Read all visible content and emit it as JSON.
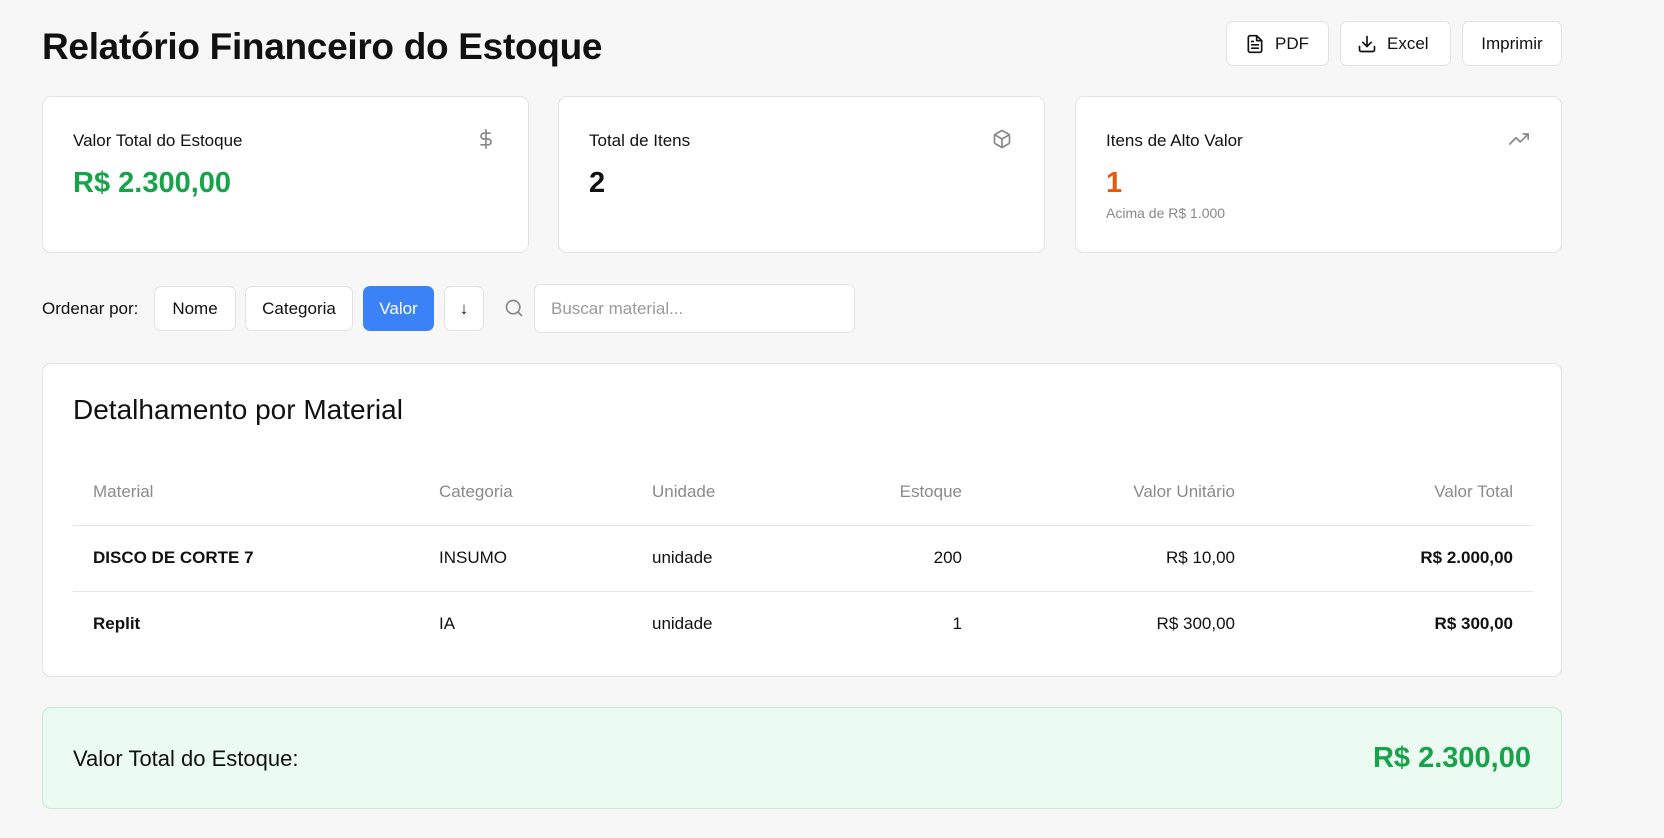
{
  "header": {
    "title": "Relatório Financeiro do Estoque",
    "actions": {
      "pdf_label": "PDF",
      "excel_label": "Excel",
      "print_label": "Imprimir"
    }
  },
  "stats": [
    {
      "label": "Valor Total do Estoque",
      "value": "R$ 2.300,00",
      "icon": "dollar-icon",
      "color": "#16a34a"
    },
    {
      "label": "Total de Itens",
      "value": "2",
      "icon": "package-icon",
      "color": "#111111"
    },
    {
      "label": "Itens de Alto Valor",
      "value": "1",
      "sub": "Acima de R$ 1.000",
      "icon": "trending-up-icon",
      "color": "#ea580c"
    }
  ],
  "toolbar": {
    "sort_label": "Ordenar por:",
    "sort_options": [
      "Nome",
      "Categoria",
      "Valor"
    ],
    "active_sort": "Valor",
    "direction": "↓",
    "search_placeholder": "Buscar material..."
  },
  "table": {
    "title": "Detalhamento por Material",
    "columns": [
      "Material",
      "Categoria",
      "Unidade",
      "Estoque",
      "Valor Unitário",
      "Valor Total"
    ],
    "rows": [
      [
        "DISCO DE CORTE 7",
        "INSUMO",
        "unidade",
        "200",
        "R$ 10,00",
        "R$ 2.000,00"
      ],
      [
        "Replit",
        "IA",
        "unidade",
        "1",
        "R$ 300,00",
        "R$ 300,00"
      ]
    ]
  },
  "footer": {
    "label": "Valor Total do Estoque:",
    "value": "R$ 2.300,00",
    "color": "#16a34a"
  },
  "colors": {
    "accent": "#3b82f6",
    "success": "#16a34a",
    "warning": "#ea580c"
  }
}
